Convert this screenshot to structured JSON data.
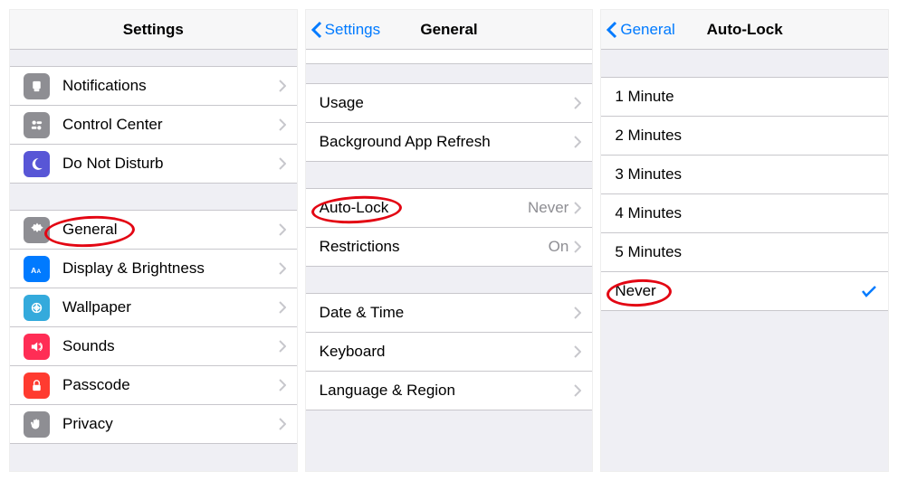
{
  "screen1": {
    "title": "Settings",
    "rows_group1": [
      {
        "label": "Notifications",
        "icon": "notifications"
      },
      {
        "label": "Control Center",
        "icon": "control"
      },
      {
        "label": "Do Not Disturb",
        "icon": "dnd"
      }
    ],
    "rows_group2": [
      {
        "label": "General",
        "icon": "general",
        "highlighted": true
      },
      {
        "label": "Display & Brightness",
        "icon": "display"
      },
      {
        "label": "Wallpaper",
        "icon": "wallpaper"
      },
      {
        "label": "Sounds",
        "icon": "sounds"
      },
      {
        "label": "Passcode",
        "icon": "passcode"
      },
      {
        "label": "Privacy",
        "icon": "privacy"
      }
    ]
  },
  "screen2": {
    "back": "Settings",
    "title": "General",
    "rows_group1": [
      {
        "label": "Usage"
      },
      {
        "label": "Background App Refresh"
      }
    ],
    "rows_group2": [
      {
        "label": "Auto-Lock",
        "value": "Never",
        "highlighted": true
      },
      {
        "label": "Restrictions",
        "value": "On"
      }
    ],
    "rows_group3": [
      {
        "label": "Date & Time"
      },
      {
        "label": "Keyboard"
      },
      {
        "label": "Language & Region"
      }
    ]
  },
  "screen3": {
    "back": "General",
    "title": "Auto-Lock",
    "options": [
      {
        "label": "1 Minute"
      },
      {
        "label": "2 Minutes"
      },
      {
        "label": "3 Minutes"
      },
      {
        "label": "4 Minutes"
      },
      {
        "label": "5 Minutes"
      },
      {
        "label": "Never",
        "selected": true,
        "highlighted": true
      }
    ]
  },
  "colors": {
    "accent": "#007aff",
    "annotation": "#e30613"
  }
}
